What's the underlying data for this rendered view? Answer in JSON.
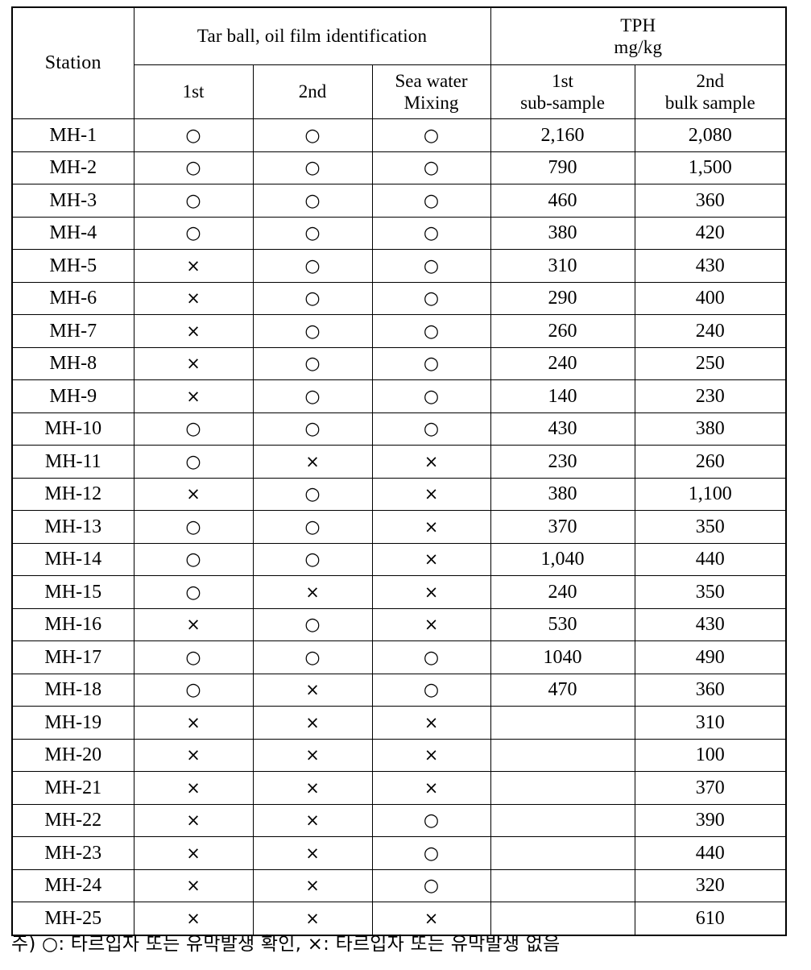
{
  "table": {
    "header": {
      "station_label": "Station",
      "group_tarball": "Tar ball, oil film identification",
      "group_tph_line1": "TPH",
      "group_tph_line2": "mg/kg",
      "sub_first": "1st",
      "sub_second": "2nd",
      "sub_sea_line1": "Sea water",
      "sub_sea_line2": "Mixing",
      "sub_tph1_line1": "1st",
      "sub_tph1_line2": "sub-sample",
      "sub_tph2_line1": "2nd",
      "sub_tph2_line2": "bulk sample"
    },
    "symbols": {
      "circle": "○",
      "cross": "×"
    },
    "rows": [
      {
        "station": "MH-1",
        "first": "○",
        "second": "○",
        "sea": "○",
        "tph1": "2,160",
        "tph2": "2,080"
      },
      {
        "station": "MH-2",
        "first": "○",
        "second": "○",
        "sea": "○",
        "tph1": "790",
        "tph2": "1,500"
      },
      {
        "station": "MH-3",
        "first": "○",
        "second": "○",
        "sea": "○",
        "tph1": "460",
        "tph2": "360"
      },
      {
        "station": "MH-4",
        "first": "○",
        "second": "○",
        "sea": "○",
        "tph1": "380",
        "tph2": "420"
      },
      {
        "station": "MH-5",
        "first": "×",
        "second": "○",
        "sea": "○",
        "tph1": "310",
        "tph2": "430"
      },
      {
        "station": "MH-6",
        "first": "×",
        "second": "○",
        "sea": "○",
        "tph1": "290",
        "tph2": "400"
      },
      {
        "station": "MH-7",
        "first": "×",
        "second": "○",
        "sea": "○",
        "tph1": "260",
        "tph2": "240"
      },
      {
        "station": "MH-8",
        "first": "×",
        "second": "○",
        "sea": "○",
        "tph1": "240",
        "tph2": "250"
      },
      {
        "station": "MH-9",
        "first": "×",
        "second": "○",
        "sea": "○",
        "tph1": "140",
        "tph2": "230"
      },
      {
        "station": "MH-10",
        "first": "○",
        "second": "○",
        "sea": "○",
        "tph1": "430",
        "tph2": "380"
      },
      {
        "station": "MH-11",
        "first": "○",
        "second": "×",
        "sea": "×",
        "tph1": "230",
        "tph2": "260"
      },
      {
        "station": "MH-12",
        "first": "×",
        "second": "○",
        "sea": "×",
        "tph1": "380",
        "tph2": "1,100"
      },
      {
        "station": "MH-13",
        "first": "○",
        "second": "○",
        "sea": "×",
        "tph1": "370",
        "tph2": "350"
      },
      {
        "station": "MH-14",
        "first": "○",
        "second": "○",
        "sea": "×",
        "tph1": "1,040",
        "tph2": "440"
      },
      {
        "station": "MH-15",
        "first": "○",
        "second": "×",
        "sea": "×",
        "tph1": "240",
        "tph2": "350"
      },
      {
        "station": "MH-16",
        "first": "×",
        "second": "○",
        "sea": "×",
        "tph1": "530",
        "tph2": "430"
      },
      {
        "station": "MH-17",
        "first": "○",
        "second": "○",
        "sea": "○",
        "tph1": "1040",
        "tph2": "490"
      },
      {
        "station": "MH-18",
        "first": "○",
        "second": "×",
        "sea": "○",
        "tph1": "470",
        "tph2": "360"
      },
      {
        "station": "MH-19",
        "first": "×",
        "second": "×",
        "sea": "×",
        "tph1": "",
        "tph2": "310"
      },
      {
        "station": "MH-20",
        "first": "×",
        "second": "×",
        "sea": "×",
        "tph1": "",
        "tph2": "100"
      },
      {
        "station": "MH-21",
        "first": "×",
        "second": "×",
        "sea": "×",
        "tph1": "",
        "tph2": "370"
      },
      {
        "station": "MH-22",
        "first": "×",
        "second": "×",
        "sea": "○",
        "tph1": "",
        "tph2": "390"
      },
      {
        "station": "MH-23",
        "first": "×",
        "second": "×",
        "sea": "○",
        "tph1": "",
        "tph2": "440"
      },
      {
        "station": "MH-24",
        "first": "×",
        "second": "×",
        "sea": "○",
        "tph1": "",
        "tph2": "320"
      },
      {
        "station": "MH-25",
        "first": "×",
        "second": "×",
        "sea": "×",
        "tph1": "",
        "tph2": "610"
      }
    ]
  },
  "footnote": {
    "text": "주) ○: 타르입자 또는 유막발생 확인, ×: 타르입자 또는 유막발생 없음"
  },
  "colors": {
    "text": "#000000",
    "background": "#ffffff",
    "border": "#000000"
  }
}
